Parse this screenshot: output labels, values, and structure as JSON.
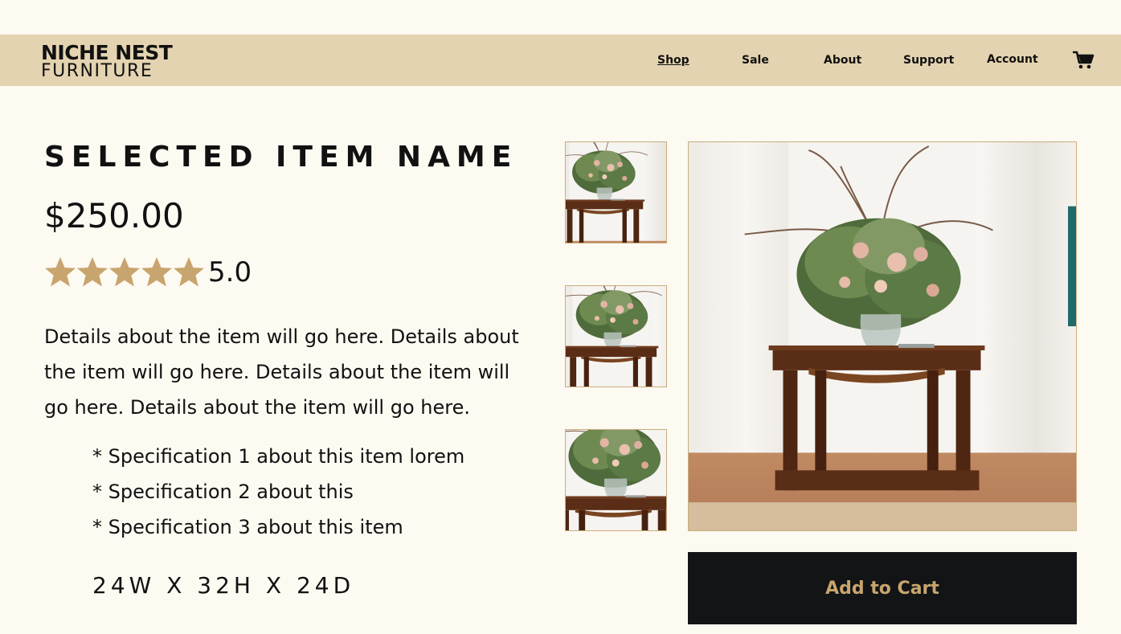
{
  "brand": {
    "line1": "NICHE NEST",
    "line2": "FURNITURE"
  },
  "nav": {
    "shop": "Shop",
    "sale": "Sale",
    "about": "About",
    "support": "Support",
    "account": "Account",
    "cart_icon": "cart-icon"
  },
  "product": {
    "name": "SELECTED ITEM NAME",
    "price": "$250.00",
    "rating": {
      "stars": 5,
      "max_stars": 5,
      "value": "5.0",
      "star_color": "#c8a56e"
    },
    "description": "Details about the item will go here. Details about the item will go here. Details about the item will go here. Details about the item will go here.",
    "specs": [
      "* Specification 1 about this item lorem",
      "* Specification 2 about this",
      "* Specification 3 about this item"
    ],
    "dimensions": "24W X 32H X 24D"
  },
  "actions": {
    "add_to_cart": "Add to Cart"
  },
  "colors": {
    "background": "#fdfaf2",
    "nav_background": "#e4d3b0",
    "accent": "#c8a56e",
    "button_background": "#121415"
  }
}
